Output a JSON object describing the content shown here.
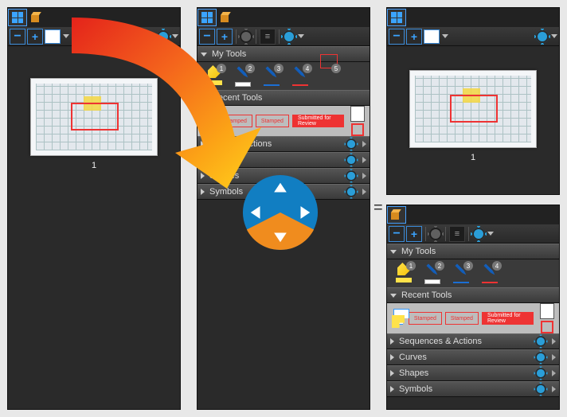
{
  "thumb": {
    "label": "1"
  },
  "sections": {
    "my_tools": "My Tools",
    "recent_tools": "Recent Tools",
    "sequences": "Sequences & Actions",
    "curves": "Curves",
    "shapes": "Shapes",
    "symbols": "Symbols",
    "p2_sequences": "ences & Actions",
    "p2_curves": "es",
    "p2_shapes": "Shapes",
    "p2_symbols": "Symbols"
  },
  "tools": {
    "badges": [
      "1",
      "2",
      "3",
      "4",
      "5"
    ]
  },
  "stamps": {
    "a": "Stamped",
    "b": "Stamped",
    "c": "Submitted for Review"
  },
  "equals": "="
}
